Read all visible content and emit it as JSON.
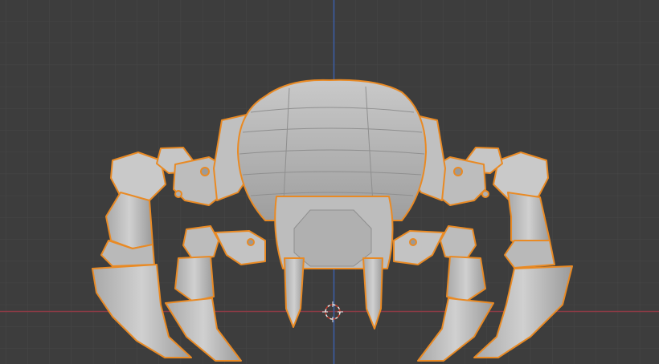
{
  "viewport": {
    "colors": {
      "background": "#3d3d3d",
      "grid_minor": "#474747",
      "grid_major": "#505050",
      "x_axis": "#8a3b45",
      "z_axis": "#3b5fa8",
      "selection_outline": "#e98a24",
      "mesh_light": "#c4c4c4",
      "mesh_mid": "#a9a9a9",
      "mesh_dark": "#8c8c8c"
    }
  },
  "object": {
    "selected": true
  },
  "icons": {
    "origin": "3d-cursor-icon"
  }
}
